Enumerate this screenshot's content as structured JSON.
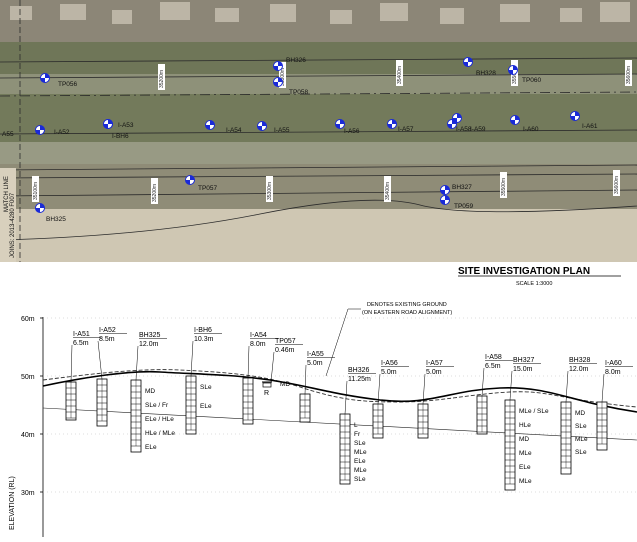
{
  "plan": {
    "probes": [
      {
        "label": "TP056"
      },
      {
        "label": "BH326"
      },
      {
        "label": "TP058"
      },
      {
        "label": "BH328"
      },
      {
        "label": "TP060"
      },
      {
        "label": "I-A52"
      },
      {
        "label": "I-A53"
      },
      {
        "label": "I-BH6"
      },
      {
        "label": "I-A54"
      },
      {
        "label": "I-A55"
      },
      {
        "label": "I-A56"
      },
      {
        "label": "I-A57"
      },
      {
        "label": "I-A58"
      },
      {
        "label": "I-A59"
      },
      {
        "label": "I-A60"
      },
      {
        "label": "I-A61"
      },
      {
        "label": "TP057"
      },
      {
        "label": "BH327"
      },
      {
        "label": "TP059"
      },
      {
        "label": "BH325"
      },
      {
        "label": "A55"
      }
    ],
    "chainages": [
      "35100m",
      "35200m",
      "35300m",
      "35400m",
      "35500m",
      "35600m"
    ],
    "match_line": "MATCH LINE",
    "joins": "JOINS: 2013-4280 F007"
  },
  "section": {
    "title": "SITE INVESTIGATION PLAN",
    "scale": "SCALE 1:3000",
    "ylabel": "ELEVATION (RL)",
    "y_ticks": [
      {
        "label": "60m",
        "rl": 60
      },
      {
        "label": "50m",
        "rl": 50
      },
      {
        "label": "40m",
        "rl": 40
      },
      {
        "label": "30m",
        "rl": 30
      }
    ],
    "annotation": "DENOTES EXISTING GROUND",
    "annotation2": "(ON EASTERN ROAD ALIGNMENT)",
    "boreholes": [
      {
        "name": "I-A51",
        "depth": "6.5m"
      },
      {
        "name": "I-A52",
        "depth": "8.5m"
      },
      {
        "name": "BH325",
        "depth": "12.0m",
        "strata": [
          "MD",
          "SLe / Fr",
          "ELe / HLe",
          "HLe / MLe",
          "ELe"
        ]
      },
      {
        "name": "I-BH6",
        "depth": "10.3m",
        "strata": [
          "SLe",
          "ELe"
        ]
      },
      {
        "name": "I-A54",
        "depth": "8.0m"
      },
      {
        "name": "TP057",
        "depth": "0.46m",
        "strata": [
          "MD"
        ],
        "symbol": "R"
      },
      {
        "name": "I-A55",
        "depth": "5.0m"
      },
      {
        "name": "BH326",
        "depth": "11.25m",
        "strata": [
          "L",
          "Fr",
          "SLe",
          "MLe",
          "ELe",
          "MLe",
          "SLe"
        ]
      },
      {
        "name": "I-A56",
        "depth": "5.0m"
      },
      {
        "name": "I-A57",
        "depth": "5.0m"
      },
      {
        "name": "I-A58",
        "depth": "6.5m"
      },
      {
        "name": "BH327",
        "depth": "15.0m",
        "strata": [
          "MLe / SLe",
          "HLe",
          "MD",
          "MLe",
          "ELe",
          "MLe"
        ]
      },
      {
        "name": "BH328",
        "depth": "12.0m",
        "strata": [
          "MD",
          "SLe",
          "MLe",
          "SLe"
        ]
      },
      {
        "name": "I-A60",
        "depth": "8.0m"
      }
    ]
  }
}
